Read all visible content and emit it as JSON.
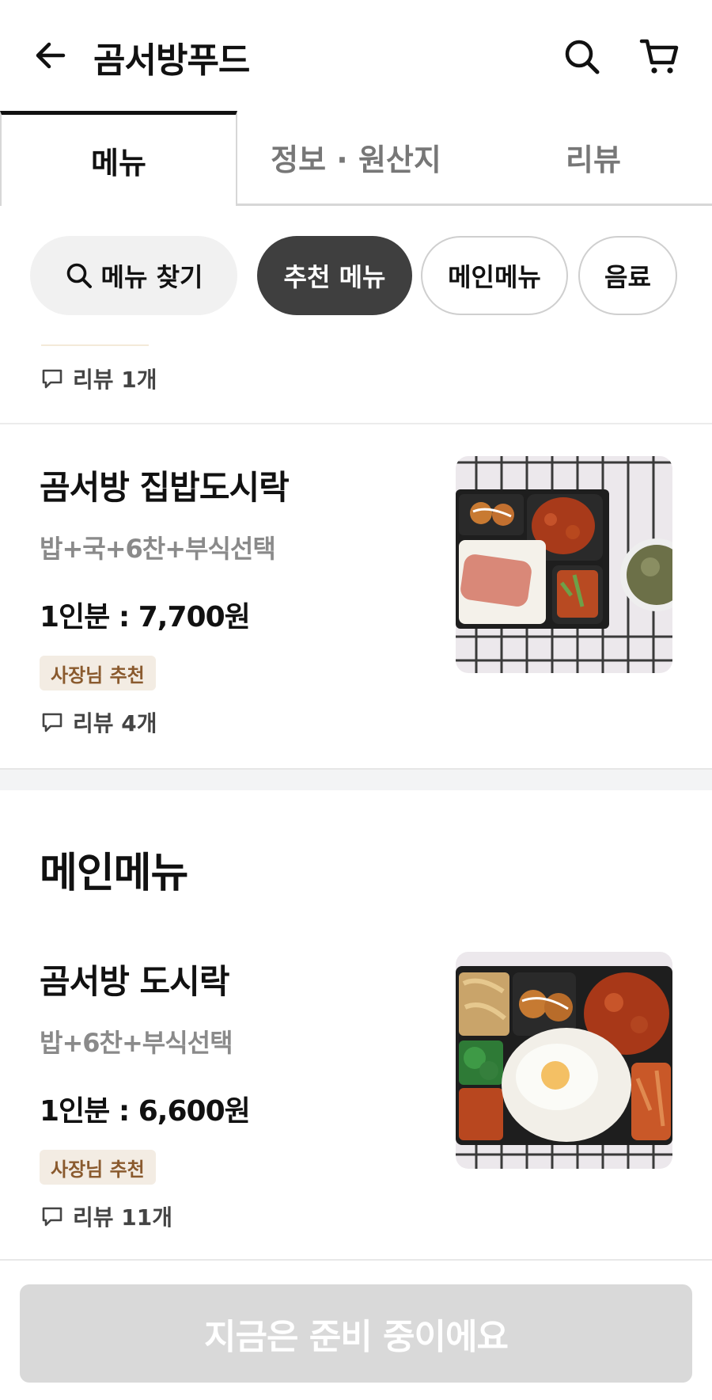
{
  "header": {
    "back_icon": "arrow-left-icon",
    "title": "곰서방푸드",
    "search_icon": "search-icon",
    "cart_icon": "cart-icon"
  },
  "tabs": [
    {
      "label": "메뉴",
      "active": true
    },
    {
      "label": "정보 · 원산지",
      "active": false
    },
    {
      "label": "리뷰",
      "active": false
    }
  ],
  "chips": {
    "search": "메뉴 찾기",
    "recommend": "추천 메뉴",
    "main": "메인메뉴",
    "drink": "음료"
  },
  "partial_item": {
    "review": "리뷰 1개"
  },
  "items": [
    {
      "name": "곰서방  집밥도시락",
      "desc": "밥+국+6찬+부식선택",
      "price": "1인분 : 7,700원",
      "badge": "사장님 추천",
      "review": "리뷰 4개"
    },
    {
      "name": "곰서방 도시락",
      "desc": "밥+6찬+부식선택",
      "price": "1인분 : 6,600원",
      "badge": "사장님 추천",
      "review": "리뷰 11개"
    }
  ],
  "section": {
    "title": "메인메뉴"
  },
  "bottom": {
    "cta": "지금은 준비 중이에요"
  }
}
